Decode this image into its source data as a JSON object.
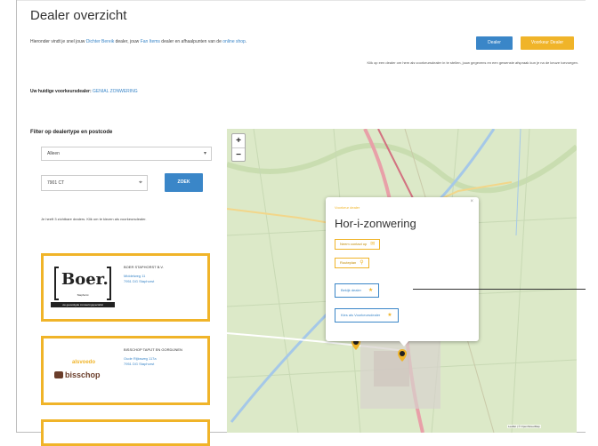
{
  "header": {
    "title": "Dealer overzicht",
    "intro_part1": "Hieronder vindt je snel jouw ",
    "intro_link1": "Dichter Bereik",
    "intro_part2": " dealer, jouw ",
    "intro_link2": "Fan Items",
    "intro_part3": " dealer en afhaalpunten van de ",
    "intro_link3": "online shop",
    "intro_part4": ".",
    "btn_primary": "Dealer",
    "btn_secondary": "Voorkeur Dealer",
    "note": "Klik op een dealer om hem als voorkeursdealer in te stellen, jouw gegevens en een gewenste afspraak kun je na de keuze toevoegen."
  },
  "current_dealer": {
    "label": "Uw huidige voorkeursdealer:",
    "value": "GENIAL ZONWERING"
  },
  "filter": {
    "heading": "Filter op dealertype en postcode",
    "type_value": "Alleen",
    "postcode_value": "7901 CT",
    "search_label": "ZOEK",
    "result_info": "Je heeft 3 zichtbare dealers. Klik om te kiezen als voorkeursdealer."
  },
  "dealers": [
    {
      "logo_word": "Boer.",
      "logo_sub": "Staphorst",
      "logo_bar": "uw gevestigde zonweringspecialist",
      "name": "BOER STAPHORST B.V.",
      "addr1": "Middelweg 11",
      "addr2": "7951 DG Staphorst"
    },
    {
      "logo_top": "alsvoedo",
      "logo_main": "bisschop",
      "name": "BISSCHOP TAPIJT EN GORDIJNEN",
      "addr1": "Oude Rijksweg 117a",
      "addr2": "7951 DG Staphorst"
    }
  ],
  "map": {
    "zoom_in": "+",
    "zoom_out": "−",
    "attribution": "Leaflet | © OpenStreetMap"
  },
  "popup": {
    "close": "×",
    "type": "Voorkeur dealer",
    "title": "Hor-i-zonwering",
    "btn_contact": "Neem contact op",
    "btn_route": "Routeplan",
    "btn_visit": "Bekijk dealer",
    "btn_preferred": "Kies als Voorkeursdealer"
  },
  "colors": {
    "accent_blue": "#3a86c8",
    "accent_orange": "#f0b429",
    "map_green": "#dce9c8"
  }
}
